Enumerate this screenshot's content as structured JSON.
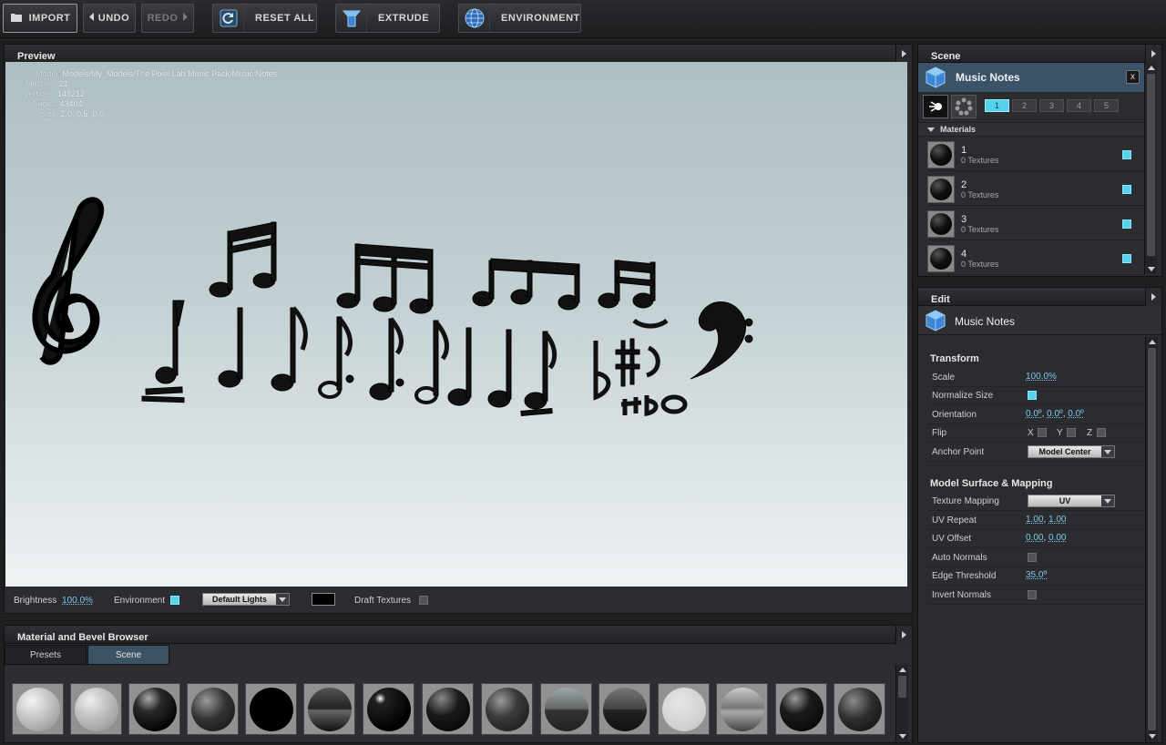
{
  "toolbar": {
    "import": "IMPORT",
    "undo": "UNDO",
    "redo": "REDO",
    "reset_all": "RESET ALL",
    "extrude": "EXTRUDE",
    "environment": "ENVIRONMENT"
  },
  "preview": {
    "title": "Preview",
    "info": {
      "model_label": "Model:",
      "model_value": "Models/My_Models/The Pixel Lab Music Pack/Music Notes",
      "meshes_label": "Meshes:",
      "meshes_value": "21",
      "vertices_label": "Vertices:",
      "vertices_value": "148212",
      "faces_label": "Faces:",
      "faces_value": "43404",
      "size_label": "Size:",
      "size_value": "2.0, 0.5, 0.0"
    },
    "bar": {
      "brightness_label": "Brightness",
      "brightness_value": "100.0%",
      "environment_label": "Environment",
      "lights_value": "Default Lights",
      "draft_label": "Draft Textures"
    }
  },
  "scene": {
    "title": "Scene",
    "object_name": "Music Notes",
    "close_label": "x",
    "tabs": [
      "1",
      "2",
      "3",
      "4",
      "5"
    ],
    "materials_label": "Materials",
    "materials": [
      {
        "name": "1",
        "sub": "0 Textures"
      },
      {
        "name": "2",
        "sub": "0 Textures"
      },
      {
        "name": "3",
        "sub": "0 Textures"
      },
      {
        "name": "4",
        "sub": "0 Textures"
      }
    ]
  },
  "edit": {
    "title": "Edit",
    "object_name": "Music Notes",
    "transform_label": "Transform",
    "scale_label": "Scale",
    "scale_value": "100.0%",
    "normalize_label": "Normalize Size",
    "orientation_label": "Orientation",
    "orientation_x": "0.0º",
    "orientation_y": "0.0º",
    "orientation_z": "0.0º",
    "flip_label": "Flip",
    "flip_x": "X",
    "flip_y": "Y",
    "flip_z": "Z",
    "anchor_label": "Anchor Point",
    "anchor_value": "Model Center",
    "surface_label": "Model Surface & Mapping",
    "texture_mapping_label": "Texture Mapping",
    "texture_mapping_value": "UV",
    "uv_repeat_label": "UV Repeat",
    "uv_repeat_a": "1.00",
    "uv_repeat_b": "1.00",
    "uv_offset_label": "UV Offset",
    "uv_offset_a": "0.00",
    "uv_offset_b": "0.00",
    "auto_normals_label": "Auto Normals",
    "edge_threshold_label": "Edge Threshold",
    "edge_threshold_value": "35.0º",
    "invert_normals_label": "Invert Normals"
  },
  "browser": {
    "title": "Material and Bevel Browser",
    "tab_presets": "Presets",
    "tab_scene": "Scene"
  },
  "colors": {
    "accent": "#55d3ee",
    "selected_tab": "#3c5366"
  }
}
